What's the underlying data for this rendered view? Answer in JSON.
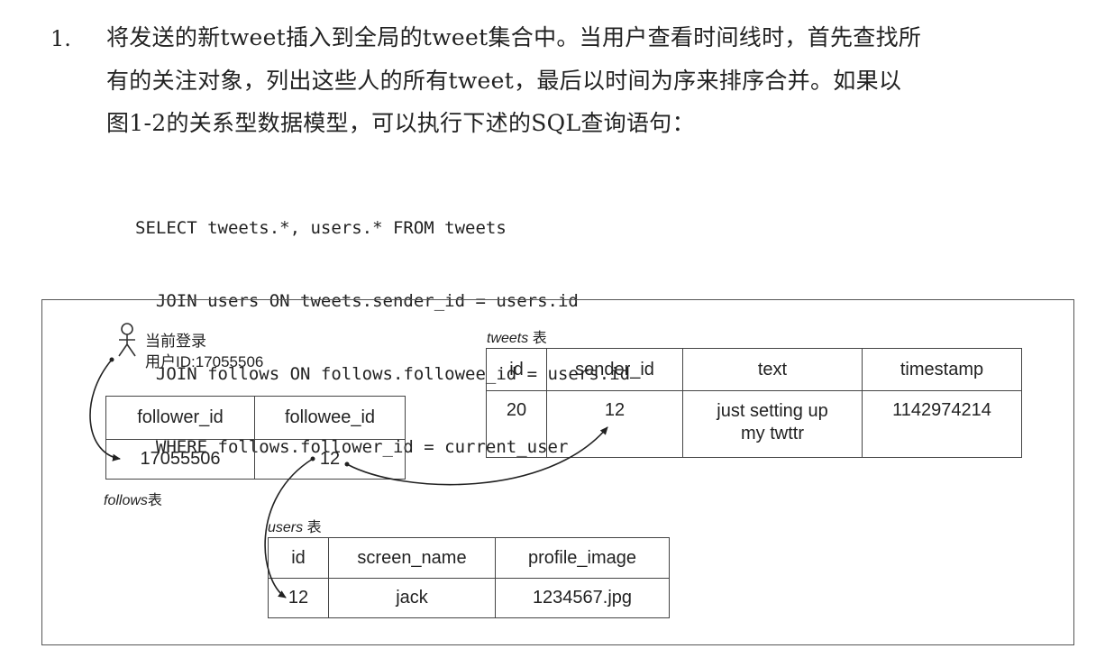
{
  "paragraph": {
    "number": "1.",
    "lines": [
      "将发送的新tweet插入到全局的tweet集合中。当用户查看时间线时，首先查找所",
      "有的关注对象，列出这些人的所有tweet，最后以时间为序来排序合并。如果以",
      "图1-2的关系型数据模型，可以执行下述的SQL查询语句："
    ]
  },
  "sql": [
    "SELECT tweets.*, users.* FROM tweets",
    "  JOIN users ON tweets.sender_id = users.id",
    "  JOIN follows ON follows.followee_id = users.id",
    "  WHERE follows.follower_id = current_user"
  ],
  "figure": {
    "current_user_label_line1": "当前登录",
    "current_user_label_line2": "用户ID:17055506",
    "follows": {
      "caption_name": "follows",
      "caption_suffix": "表",
      "headers": [
        "follower_id",
        "followee_id"
      ],
      "row": [
        "17055506",
        "12"
      ]
    },
    "tweets": {
      "caption_name": "tweets",
      "caption_suffix": " 表",
      "headers": [
        "id",
        "sender_id",
        "text",
        "timestamp"
      ],
      "row": [
        "20",
        "12",
        "just setting up my twttr",
        "1142974214"
      ]
    },
    "users": {
      "caption_name": "users",
      "caption_suffix": " 表",
      "headers": [
        "id",
        "screen_name",
        "profile_image"
      ],
      "row": [
        "12",
        "jack",
        "1234567.jpg"
      ]
    },
    "icons": [
      "user-icon",
      "arrow-icon"
    ]
  }
}
